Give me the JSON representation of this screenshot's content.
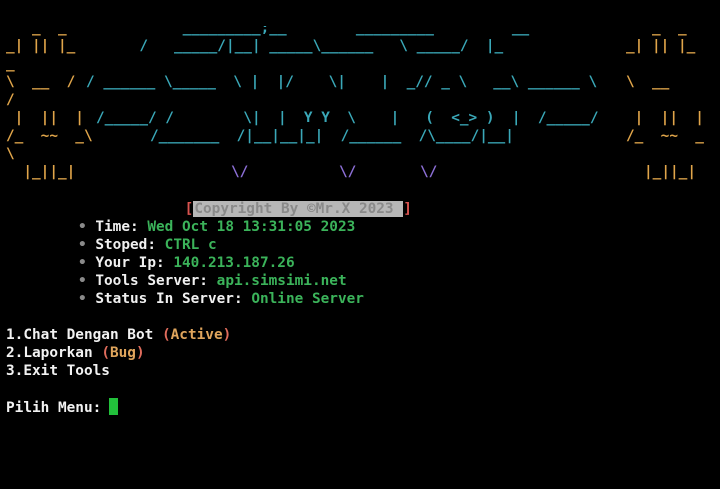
{
  "banner": {
    "colors": {
      "orange": "#e0a54a",
      "cyan": "#3aa8b8",
      "purple": "#8c6fd6"
    }
  },
  "copyright": {
    "open_bracket": "[",
    "text": "Copyright By ©Mr.X 2023 ",
    "close_bracket": "]"
  },
  "info": {
    "bullet": "•",
    "items": [
      {
        "label": "Time:",
        "value": "Wed Oct 18 13:31:05 2023"
      },
      {
        "label": "Stoped:",
        "value": "CTRL c"
      },
      {
        "label": "Your Ip:",
        "value": "140.213.187.26"
      },
      {
        "label": "Tools Server:",
        "value": "api.simsimi.net"
      },
      {
        "label": "Status In Server:",
        "value": "Online Server"
      }
    ]
  },
  "menu": {
    "items": [
      {
        "label": "1.Chat Dengan Bot",
        "tag_open": "(",
        "tag": "Active",
        "tag_close": ")"
      },
      {
        "label": "2.Laporkan",
        "tag_open": "(",
        "tag": "Bug",
        "tag_close": ")"
      },
      {
        "label": "3.Exit Tools",
        "tag_open": "",
        "tag": "",
        "tag_close": ""
      }
    ]
  },
  "prompt": {
    "label": "Pilih Menu:"
  },
  "colors": {
    "background": "#000000",
    "text": "#f0f0f0",
    "value_green": "#3bb35a",
    "tag_red": "#e06c5c",
    "tag_orange": "#e0a55c",
    "cursor_green": "#22c03b"
  }
}
